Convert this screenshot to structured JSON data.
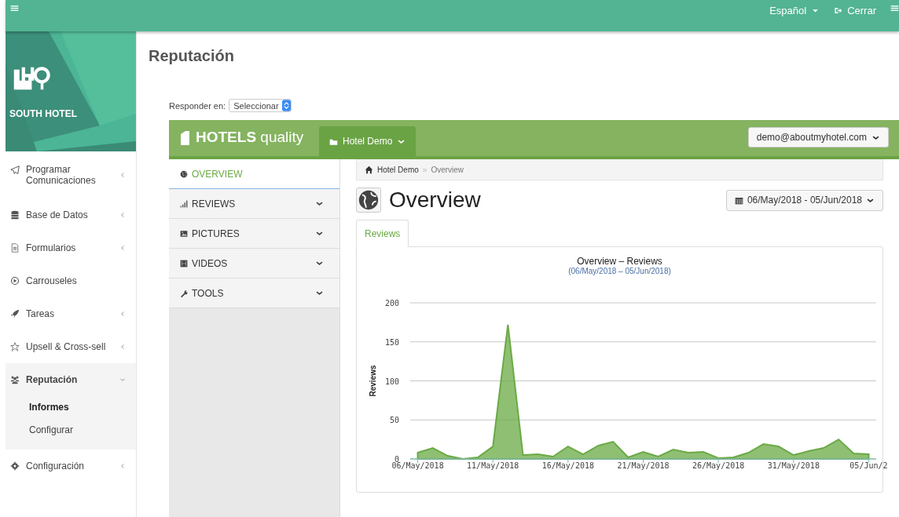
{
  "topbar": {
    "language": "Español",
    "logout": "Cerrar"
  },
  "sidebar": {
    "brand": "SOUTH HOTEL",
    "items": [
      {
        "label": "Programar Comunicaciones",
        "has_children": true,
        "expanded": false
      },
      {
        "label": "Base de Datos",
        "has_children": true,
        "expanded": false
      },
      {
        "label": "Formularios",
        "has_children": true,
        "expanded": false
      },
      {
        "label": "Carrouseles",
        "has_children": false,
        "expanded": false
      },
      {
        "label": "Tareas",
        "has_children": true,
        "expanded": false
      },
      {
        "label": "Upsell & Cross-sell",
        "has_children": true,
        "expanded": false
      },
      {
        "label": "Reputación",
        "has_children": true,
        "expanded": true,
        "children": [
          {
            "label": "Informes",
            "selected": true
          },
          {
            "label": "Configurar",
            "selected": false
          }
        ]
      },
      {
        "label": "Configuración",
        "has_children": true,
        "expanded": false
      }
    ]
  },
  "page": {
    "title": "Reputación",
    "respond_label": "Responder en:",
    "respond_select": "Seleccionar"
  },
  "app": {
    "brand": "**HOTELS** quality",
    "hotel_menu": "Hotel Demo",
    "account": "demo@aboutmyhotel.com",
    "nav": [
      {
        "label": "OVERVIEW",
        "selected": true,
        "expandable": false
      },
      {
        "label": "REVIEWS",
        "selected": false,
        "expandable": true
      },
      {
        "label": "PICTURES",
        "selected": false,
        "expandable": true
      },
      {
        "label": "VIDEOS",
        "selected": false,
        "expandable": true
      },
      {
        "label": "TOOLS",
        "selected": false,
        "expandable": true
      }
    ],
    "breadcrumb": [
      "Hotel Demo",
      "Overview"
    ],
    "breadcrumb_separator": "»",
    "heading": "Overview",
    "date_range": "06/May/2018 - 05/Jun/2018",
    "tabs": [
      {
        "label": "Reviews",
        "selected": true
      }
    ],
    "chart_title": "Overview – Reviews",
    "chart_subtitle": "(06/May/2018 – 05/Jun/2018)",
    "chart_data": {
      "type": "area",
      "grid": true,
      "ylabel": "Reviews",
      "ylim": [
        0,
        200
      ],
      "yticks": [
        0,
        50,
        100,
        150,
        200
      ],
      "categories": [
        "06/May/2018",
        null,
        null,
        null,
        null,
        "11/May/2018",
        null,
        null,
        null,
        null,
        "16/May/2018",
        null,
        null,
        null,
        null,
        "21/May/2018",
        null,
        null,
        null,
        null,
        "26/May/2018",
        null,
        null,
        null,
        null,
        "31/May/2018",
        null,
        null,
        null,
        null,
        "05/Jun/2"
      ],
      "series": [
        {
          "color": "#6aaa44",
          "values": [
            8,
            14,
            4,
            0,
            2,
            16,
            172,
            5,
            6,
            3,
            16,
            6,
            17,
            22,
            2,
            9,
            3,
            12,
            8,
            9,
            1,
            2,
            8,
            19,
            16,
            5,
            10,
            14,
            25,
            7,
            6
          ]
        }
      ]
    }
  }
}
